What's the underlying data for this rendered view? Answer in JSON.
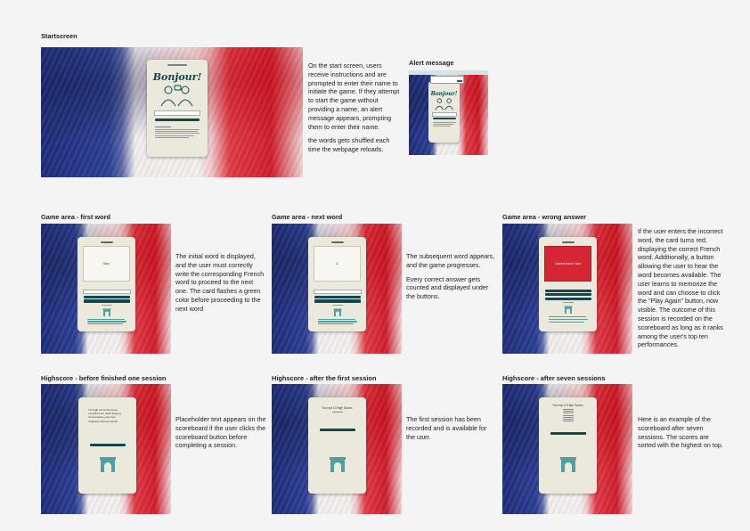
{
  "startscreen": {
    "title": "Startscreen",
    "description_1": "On the start screen, users receive instructions and are prompted to enter their name to initiate the game. If they attempt to start the game without providing a name, an alert message appears, prompting them to enter their name.",
    "description_2": "the words gets shuffled each time the webpage reloads.",
    "card_heading": "Bonjour!"
  },
  "alert": {
    "title": "Alert message",
    "card_heading": "Bonjour!"
  },
  "game_first": {
    "title": "Game area - first word",
    "description": "The initial word is displayed, and the user must correctly write the corresponding French word to proceed to the next one. The card flashes a green color before proceeding to the next word",
    "word": "lion"
  },
  "game_next": {
    "title": "Game area - next word",
    "description_1": "The subsequent word appears, and the game progresses.",
    "description_2": "Every correct answer gets counted and displayed under the buttons.",
    "word": "1"
  },
  "game_wrong": {
    "title": "Game area - wrong answer",
    "description": "If the user enters the incorrect word, the card turns red, displaying the correct French word. Additionally, a button allowing the user to hear the word becomes available. The user learns to memorize the word and can choose to click the \"Play Again\" button, now visible. The outcome of this session is recorded on the scoreboard as long as it ranks among the user's top ten performances.",
    "word": "Correct word = lion"
  },
  "hs_before": {
    "title": "Highscore - before finished one session",
    "description": "Placeholder text appears on the scoreboard if the user clicks the scoreboard button before completing a session.",
    "card_text": "No high score has been recorded yet. Start playing and surpass your own linguistic achievements!"
  },
  "hs_first": {
    "title": "Highscore - after the first session",
    "description": "The first session has been recorded and is available for the user.",
    "card_heading": "Your top 10 High Scores"
  },
  "hs_seven": {
    "title": "Highscore - after seven sessions",
    "description": "Here is an example of the scoreboard after seven sessions. The scores are sorted with the highest on top.",
    "card_heading": "Your top 10 High Scores"
  },
  "colors": {
    "card": "#ebe8dc",
    "teal": "#13474d",
    "red": "#d62636",
    "blue": "#1d2c7a"
  }
}
